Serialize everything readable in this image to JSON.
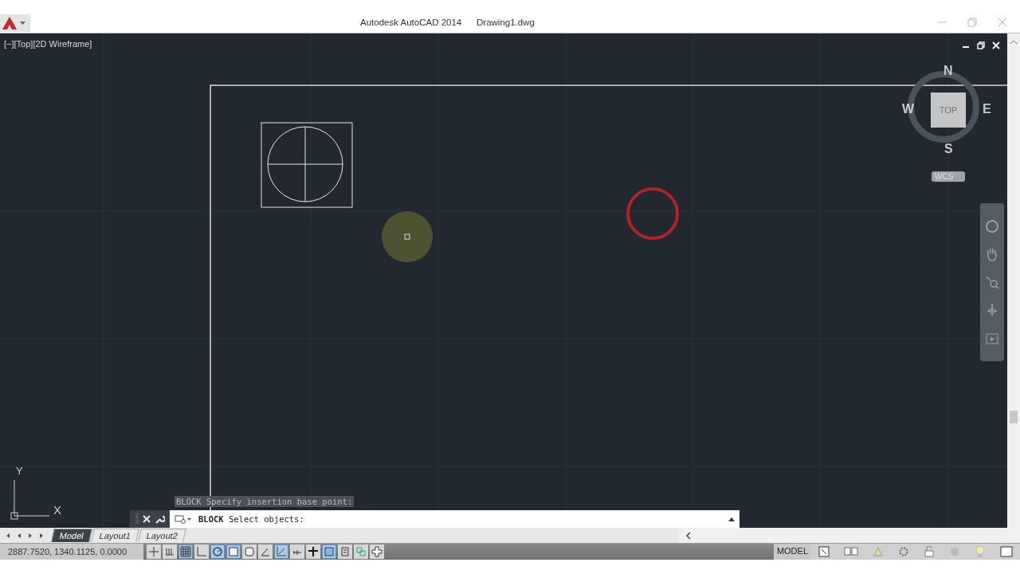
{
  "window": {
    "title": "Autodesk AutoCAD 2014",
    "document": "Drawing1.dwg"
  },
  "viewport": {
    "label": "[−][Top][2D Wireframe]"
  },
  "viewcube": {
    "north": "N",
    "south": "S",
    "east": "E",
    "west": "W",
    "face": "TOP",
    "ucs": "WCS"
  },
  "ucs_icon": {
    "x_label": "X",
    "y_label": "Y"
  },
  "command_line": {
    "history": "BLOCK Specify insertion base point:",
    "command": "BLOCK",
    "prompt": "Select objects:"
  },
  "layout_tabs": [
    {
      "label": "Model",
      "selected": true
    },
    {
      "label": "Layout1",
      "selected": false
    },
    {
      "label": "Layout2",
      "selected": false
    }
  ],
  "status_bar": {
    "coordinates": "2887.7520, 1340.1125, 0.0000",
    "space": "MODEL",
    "toggles": [
      {
        "kind": "infer",
        "on": false
      },
      {
        "kind": "snap",
        "on": false
      },
      {
        "kind": "grid",
        "on": true
      },
      {
        "kind": "ortho",
        "on": false
      },
      {
        "kind": "polar",
        "on": true
      },
      {
        "kind": "osnap",
        "on": true
      },
      {
        "kind": "osnap3d",
        "on": false
      },
      {
        "kind": "angle",
        "on": false
      },
      {
        "kind": "ucs",
        "on": true
      },
      {
        "kind": "dyn",
        "on": false
      },
      {
        "kind": "cross",
        "on": false
      },
      {
        "kind": "transparency",
        "on": true
      },
      {
        "kind": "quick",
        "on": false
      },
      {
        "kind": "cycle",
        "on": false
      },
      {
        "kind": "plus",
        "on": false
      }
    ]
  }
}
